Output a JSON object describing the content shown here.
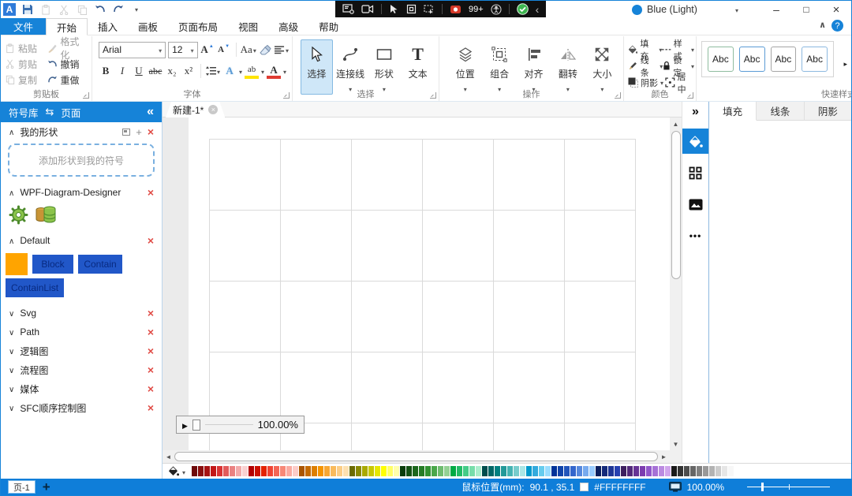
{
  "colors": {
    "accent": "#1683d8",
    "statusbar": "#0f7ed9",
    "selected_tool_bg": "#cfe7f8"
  },
  "titlebar": {
    "theme_label": "Blue (Light)",
    "capture_badge": "99+"
  },
  "ribbon": {
    "tabs": [
      "文件",
      "开始",
      "插入",
      "画板",
      "页面布局",
      "视图",
      "高级",
      "帮助"
    ],
    "clipboard": {
      "label": "剪贴板",
      "paste": "粘贴",
      "format": "格式化",
      "cut": "剪贴",
      "undo": "撤销",
      "copy": "复制",
      "redo": "重做"
    },
    "font": {
      "label": "字体",
      "family": "Arial",
      "size": "12",
      "bold": "B",
      "italic": "I",
      "underline": "U",
      "strike": "abc",
      "subscript": "x₂",
      "superscript": "x²",
      "grow": "A",
      "shrink": "A",
      "case": "Aa",
      "effect": "A",
      "highlight": "ab",
      "fontcolor": "A"
    },
    "selection": {
      "label": "选择",
      "select": "选择",
      "connector": "连接线",
      "shape": "形状",
      "text": "文本"
    },
    "operations": {
      "label": "操作",
      "position": "位置",
      "group": "组合",
      "align": "对齐",
      "flip": "翻转",
      "size": "大小"
    },
    "color_group": {
      "label": "颜色",
      "fill": "填充",
      "style": "样式",
      "line": "线条",
      "lock": "锁定",
      "shadow": "阴影",
      "center": "居中"
    },
    "quick_styles": {
      "label": "快速样式",
      "items": [
        {
          "label": "Abc",
          "border": "#8fbc9f"
        },
        {
          "label": "Abc",
          "border": "#5b9bd5"
        },
        {
          "label": "Abc",
          "border": "#a6a6a6"
        },
        {
          "label": "Abc",
          "border": "#8db9e0"
        }
      ]
    }
  },
  "sidebar": {
    "tab_symbols": "符号库",
    "tab_pages": "页面",
    "my_shapes": {
      "name": "我的形状",
      "drop_hint": "添加形状到我的符号"
    },
    "designer": {
      "name": "WPF-Diagram-Designer"
    },
    "default_section": {
      "name": "Default",
      "swatch_color": "#ffa400",
      "items": [
        {
          "label": "Block",
          "bg": "#2157c8"
        },
        {
          "label": "Contain",
          "bg": "#2157c8"
        },
        {
          "label": "ContainList",
          "bg": "#2157c8"
        }
      ]
    },
    "collapsed_sections": [
      "Svg",
      "Path",
      "逻辑图",
      "流程图",
      "媒体",
      "SFC顺序控制图"
    ]
  },
  "canvas": {
    "tab_title": "新建-1*",
    "zoom_label": "100.00%"
  },
  "right_panel": {
    "tabs": [
      "填充",
      "线条",
      "阴影"
    ]
  },
  "palette": {
    "colors": [
      "#6e0b0b",
      "#8a0f0f",
      "#a61313",
      "#c21717",
      "#d93434",
      "#e25b5b",
      "#ea8282",
      "#f2aaaa",
      "#f9d1d1",
      "#b30000",
      "#cc1100",
      "#e42200",
      "#f04433",
      "#f46655",
      "#f78877",
      "#faaaa0",
      "#fcccc8",
      "#aa5500",
      "#c46a00",
      "#dd7f00",
      "#f59400",
      "#f7a733",
      "#f9ba5c",
      "#fbcd86",
      "#fde0b0",
      "#6b6b00",
      "#8a8a00",
      "#a9a900",
      "#c8c800",
      "#e7e700",
      "#ffff00",
      "#ffff66",
      "#ffffaa",
      "#0b3d0b",
      "#145214",
      "#1d671d",
      "#267c26",
      "#329232",
      "#4aa74a",
      "#6fbc6f",
      "#94d194",
      "#00aa44",
      "#22bb66",
      "#44cc88",
      "#77ddaa",
      "#aaeecc",
      "#004d4d",
      "#006666",
      "#008080",
      "#229999",
      "#44b3b3",
      "#77cccc",
      "#aae6e6",
      "#0099cc",
      "#33aadd",
      "#66ccee",
      "#99ddff",
      "#003399",
      "#1144aa",
      "#2255bb",
      "#3366cc",
      "#5588dd",
      "#77aaee",
      "#99ccff",
      "#0b1f5f",
      "#142a7a",
      "#1d3595",
      "#2640b0",
      "#3d1f5f",
      "#52297a",
      "#673395",
      "#7c3db0",
      "#9157cb",
      "#a671d6",
      "#bb8be1",
      "#d0a5ec",
      "#1a1a1a",
      "#333333",
      "#4d4d4d",
      "#666666",
      "#808080",
      "#999999",
      "#b3b3b3",
      "#cccccc",
      "#e6e6e6",
      "#f7f7f7"
    ]
  },
  "statusbar": {
    "page_label": "页-1",
    "mouse_label": "鼠标位置(mm):",
    "mouse_value": "90.1 , 35.1",
    "color_value": "#FFFFFFFF",
    "zoom_value": "100.00%"
  }
}
